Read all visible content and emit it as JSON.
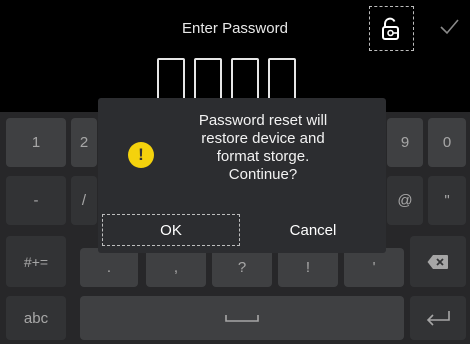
{
  "header": {
    "title": "Enter Password"
  },
  "keyboard": {
    "row1": [
      "1",
      "2",
      "9",
      "0"
    ],
    "row2": [
      "-",
      "/",
      "@",
      "\""
    ],
    "row3": [
      "#+=",
      ".",
      ",",
      "?",
      "!",
      "'"
    ],
    "abc_label": "abc"
  },
  "dialog": {
    "message_lines": [
      "Password reset will",
      "restore device and",
      "format storge.",
      "Continue?"
    ],
    "warning_glyph": "!",
    "ok_label": "OK",
    "cancel_label": "Cancel"
  },
  "colors": {
    "background": "#000000",
    "keyboard": "#3c3d40",
    "key": "#626366",
    "dialog": "#2c2d30",
    "warning": "#f4d20d"
  }
}
